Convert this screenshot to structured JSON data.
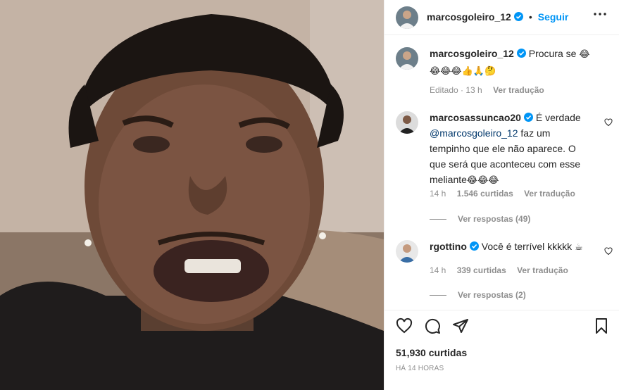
{
  "header": {
    "username": "marcosgoleiro_12",
    "follow_label": "Seguir",
    "dot": "•"
  },
  "caption": {
    "username": "marcosgoleiro_12",
    "text": "Procura se",
    "emojis_line1": "😂",
    "emojis_line2": "😂😂😂👍🙏🤔",
    "edited": "Editado · 13 h",
    "translate": "Ver tradução"
  },
  "comments": [
    {
      "username": "marcosassuncao20",
      "line1": "É verdade",
      "mention": "@marcosgoleiro_12",
      "line2_rest": " faz um",
      "line3": "tempinho que ele não aparece. O",
      "line4": "que será que aconteceu com esse",
      "line5": "meliante",
      "line5_emojis": "😂😂😂",
      "time": "14 h",
      "likes": "1.546 curtidas",
      "translate": "Ver tradução",
      "replies": "Ver respostas (49)"
    },
    {
      "username": "rgottino",
      "text": "Você é terrível kkkkk",
      "emoji": "☕",
      "time": "14 h",
      "likes": "339 curtidas",
      "translate": "Ver tradução",
      "replies": "Ver respostas (2)"
    }
  ],
  "footer": {
    "likes": "51,930 curtidas",
    "time": "HÁ 14 HORAS"
  },
  "colors": {
    "accent": "#0095f6",
    "muted": "#8e8e8e",
    "text": "#262626",
    "verified": "#0095f6"
  },
  "icons": [
    "heart-icon",
    "comment-icon",
    "share-icon",
    "bookmark-icon",
    "more-icon",
    "verified-icon"
  ]
}
